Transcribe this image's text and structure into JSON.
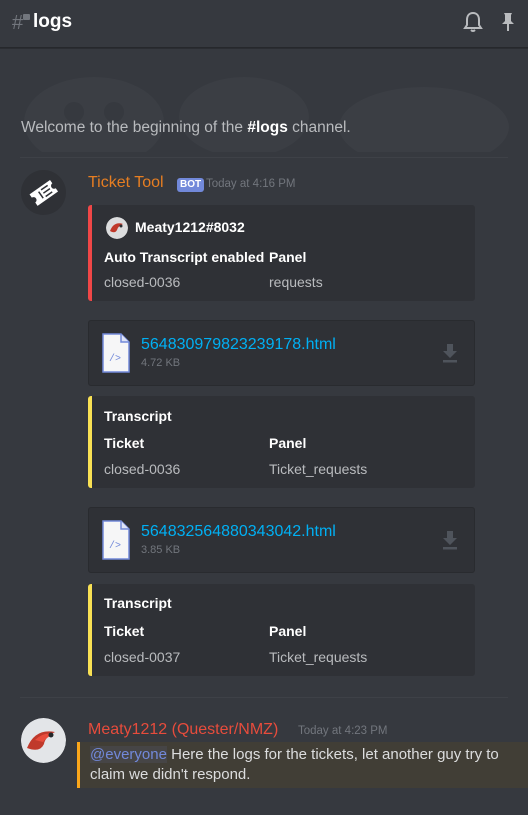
{
  "header": {
    "channel_name": "logs"
  },
  "welcome": {
    "prefix": "Welcome to the beginning of the ",
    "channel": "#logs",
    "suffix": " channel."
  },
  "message1": {
    "author": "Ticket Tool",
    "bot_tag": "BOT",
    "timestamp": "Today at 4:16 PM",
    "embed1": {
      "author": "Meaty1212#8032",
      "fields": [
        {
          "name": "Auto Transcript enabled",
          "value": "closed-0036"
        },
        {
          "name": "Panel",
          "value": "requests"
        }
      ]
    },
    "attachment1": {
      "name": "564830979823239178.html",
      "size": "4.72 KB"
    },
    "embed2": {
      "title": "Transcript",
      "fields": [
        {
          "name": "Ticket",
          "value": "closed-0036"
        },
        {
          "name": "Panel",
          "value": "Ticket_requests"
        }
      ]
    },
    "attachment2": {
      "name": "564832564880343042.html",
      "size": "3.85 KB"
    },
    "embed3": {
      "title": "Transcript",
      "fields": [
        {
          "name": "Ticket",
          "value": "closed-0037"
        },
        {
          "name": "Panel",
          "value": "Ticket_requests"
        }
      ]
    }
  },
  "message2": {
    "author": "Meaty1212 (Quester/NMZ)",
    "timestamp": "Today at 4:23 PM",
    "mention": "@everyone",
    "text": " Here the logs for the tickets, let another guy try to claim we didn't respond."
  },
  "colors": {
    "background": "#36393f",
    "embed_bg": "#2f3136",
    "bot_name": "#e67e22",
    "user_name": "#e74c3c",
    "embed_red": "#f04747",
    "embed_yellow": "#f9e154",
    "link": "#00b0f4",
    "mention_bar": "#faa61a"
  },
  "icons": [
    "text-channel-hash-icon",
    "bell-icon",
    "pin-icon",
    "ticket-icon",
    "file-code-icon",
    "download-icon"
  ]
}
